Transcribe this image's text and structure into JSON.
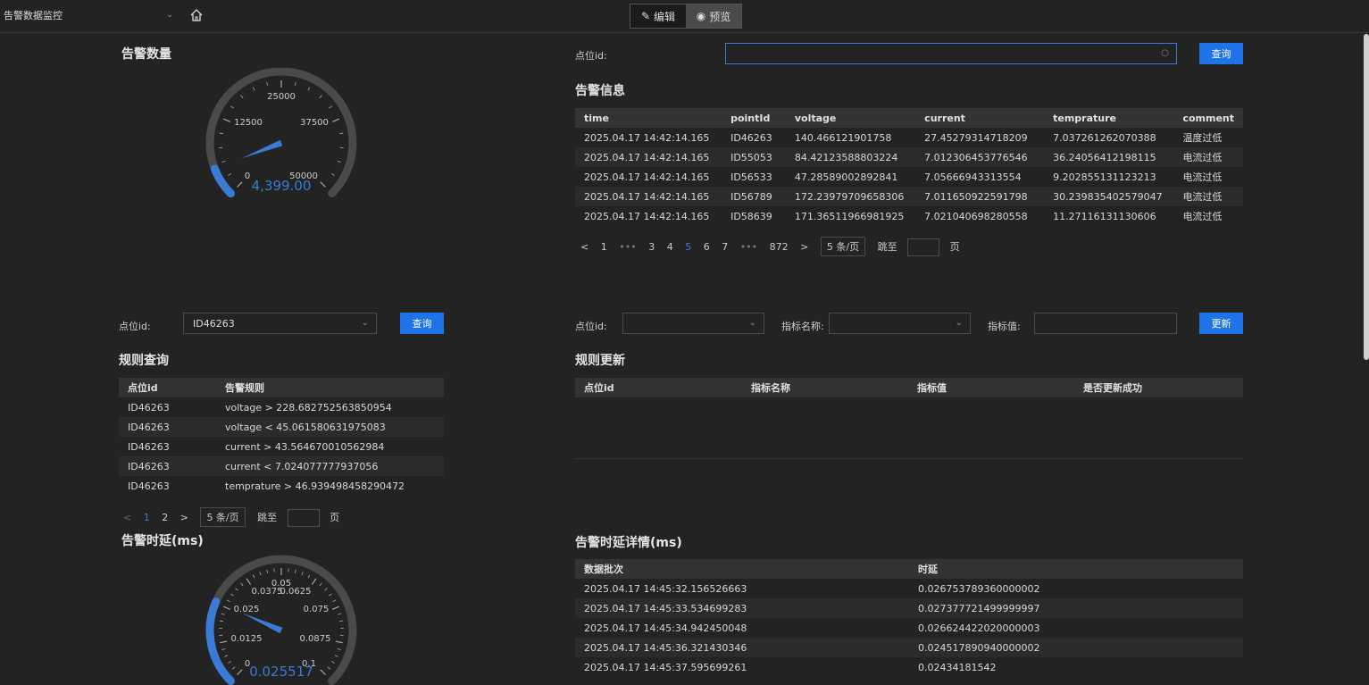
{
  "topbar": {
    "app_title": "告警数据监控",
    "edit_label": "编辑",
    "preview_label": "预览"
  },
  "alarm_count": {
    "title": "告警数量",
    "ticks": [
      "0",
      "12500",
      "25000",
      "37500",
      "50000"
    ],
    "value_text": "4,399.00",
    "value": 4399,
    "max": 50000,
    "accent": "#3a7bd5"
  },
  "alarm_info": {
    "search_label": "点位id:",
    "search_value": "",
    "query_label": "查询",
    "title": "告警信息",
    "columns": [
      "time",
      "pointId",
      "voltage",
      "current",
      "temprature",
      "comment"
    ],
    "rows": [
      [
        "2025.04.17 14:42:14.165",
        "ID46263",
        "140.466121901758",
        "27.45279314718209",
        "7.037261262070388",
        "温度过低"
      ],
      [
        "2025.04.17 14:42:14.165",
        "ID55053",
        "84.42123588803224",
        "7.012306453776546",
        "36.24056412198115",
        "电流过低"
      ],
      [
        "2025.04.17 14:42:14.165",
        "ID56533",
        "47.28589002892841",
        "7.05666943313554",
        "9.202855131123213",
        "电流过低"
      ],
      [
        "2025.04.17 14:42:14.165",
        "ID56789",
        "172.23979709658306",
        "7.011650922591798",
        "30.239835402579047",
        "电流过低"
      ],
      [
        "2025.04.17 14:42:14.165",
        "ID58639",
        "171.36511966981925",
        "7.021040698280558",
        "11.27116131130606",
        "电流过低"
      ]
    ],
    "pager": {
      "prev": "<",
      "pages_before": [
        "1",
        "•••",
        "3",
        "4"
      ],
      "current": "5",
      "pages_after": [
        "6",
        "7",
        "•••",
        "872"
      ],
      "next": ">",
      "page_size": "5 条/页",
      "jump_label": "跳至",
      "page_suffix": "页"
    }
  },
  "rule_query": {
    "label": "点位id:",
    "selected": "ID46263",
    "query_label": "查询",
    "title": "规则查询",
    "columns": [
      "点位id",
      "告警规则"
    ],
    "rows": [
      [
        "ID46263",
        "voltage > 228.682752563850954"
      ],
      [
        "ID46263",
        "voltage < 45.061580631975083"
      ],
      [
        "ID46263",
        "current > 43.564670010562984"
      ],
      [
        "ID46263",
        "current < 7.024077777937056"
      ],
      [
        "ID46263",
        "temprature > 46.939498458290472"
      ]
    ],
    "pager": {
      "prev": "<",
      "current": "1",
      "other": "2",
      "next": ">",
      "page_size": "5 条/页",
      "jump_label": "跳至",
      "page_suffix": "页"
    }
  },
  "rule_update": {
    "point_label": "点位id:",
    "metric_label": "指标名称:",
    "value_label": "指标值:",
    "update_label": "更新",
    "title": "规则更新",
    "columns": [
      "点位id",
      "指标名称",
      "指标值",
      "是否更新成功"
    ]
  },
  "latency": {
    "title": "告警时延(ms)",
    "ticks": [
      "0",
      "0.0125",
      "0.025",
      "0.0375",
      "0.05",
      "0.0625",
      "0.075",
      "0.0875",
      "0.1"
    ],
    "value_text": "0.025517",
    "value": 0.025517,
    "max": 0.1
  },
  "latency_detail": {
    "title": "告警时延详情(ms)",
    "columns": [
      "数据批次",
      "时延"
    ],
    "rows": [
      [
        "2025.04.17 14:45:32.156526663",
        "0.026753789360000002"
      ],
      [
        "2025.04.17 14:45:33.534699283",
        "0.027377721499999997"
      ],
      [
        "2025.04.17 14:45:34.942450048",
        "0.026624422020000003"
      ],
      [
        "2025.04.17 14:45:36.321430346",
        "0.024517890940000002"
      ],
      [
        "2025.04.17 14:45:37.595699261",
        "0.02434181542"
      ]
    ]
  }
}
